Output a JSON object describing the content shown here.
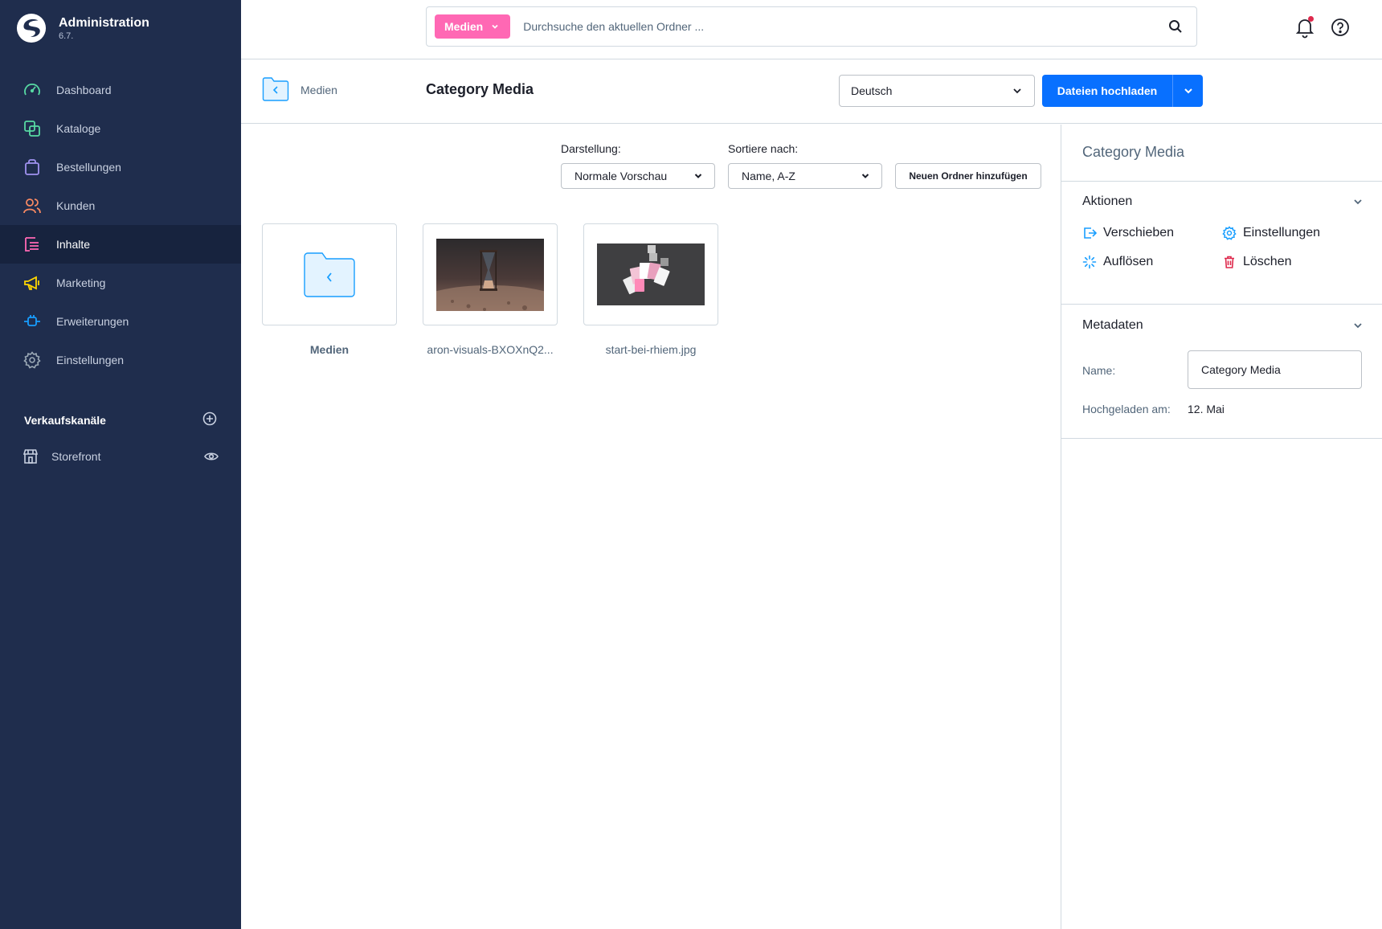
{
  "brand": {
    "title": "Administration",
    "version": "6.7."
  },
  "nav": {
    "items": [
      {
        "label": "Dashboard",
        "icon": "dashboard-icon",
        "color": "#57d9a3"
      },
      {
        "label": "Kataloge",
        "icon": "catalog-icon",
        "color": "#57d9a3"
      },
      {
        "label": "Bestellungen",
        "icon": "orders-icon",
        "color": "#a092f0"
      },
      {
        "label": "Kunden",
        "icon": "customers-icon",
        "color": "#f88962"
      },
      {
        "label": "Inhalte",
        "icon": "content-icon",
        "color": "#ff68b4"
      },
      {
        "label": "Marketing",
        "icon": "marketing-icon",
        "color": "#ffd700"
      },
      {
        "label": "Erweiterungen",
        "icon": "extensions-icon",
        "color": "#189eff"
      },
      {
        "label": "Einstellungen",
        "icon": "settings-icon",
        "color": "#9aa8b5"
      }
    ],
    "active": "Inhalte"
  },
  "sales_channels": {
    "heading": "Verkaufskanäle",
    "items": [
      {
        "label": "Storefront"
      }
    ]
  },
  "search": {
    "type_label": "Medien",
    "placeholder": "Durchsuche den aktuellen Ordner ..."
  },
  "smartbar": {
    "breadcrumb": "Medien",
    "title": "Category Media",
    "language": "Deutsch",
    "upload_label": "Dateien hochladen"
  },
  "toolbar": {
    "view_label": "Darstellung:",
    "view_value": "Normale Vorschau",
    "sort_label": "Sortiere nach:",
    "sort_value": "Name, A-Z",
    "new_folder_label": "Neuen Ordner hinzufügen"
  },
  "media_items": [
    {
      "label": "Medien",
      "type": "parent-folder"
    },
    {
      "label": "aron-visuals-BXOXnQ2...",
      "type": "image"
    },
    {
      "label": "start-bei-rhiem.jpg",
      "type": "image"
    }
  ],
  "sidebar_right": {
    "title": "Category Media",
    "actions_heading": "Aktionen",
    "actions": {
      "move": "Verschieben",
      "settings": "Einstellungen",
      "dissolve": "Auflösen",
      "delete": "Löschen"
    },
    "metadata_heading": "Metadaten",
    "name_label": "Name:",
    "name_value": "Category Media",
    "uploaded_label": "Hochgeladen am:",
    "uploaded_value": "12. Mai"
  },
  "colors": {
    "primary": "#0870ff",
    "content_accent": "#ff68b4",
    "sidebar_bg": "#1f2d4d",
    "danger": "#de294c"
  }
}
